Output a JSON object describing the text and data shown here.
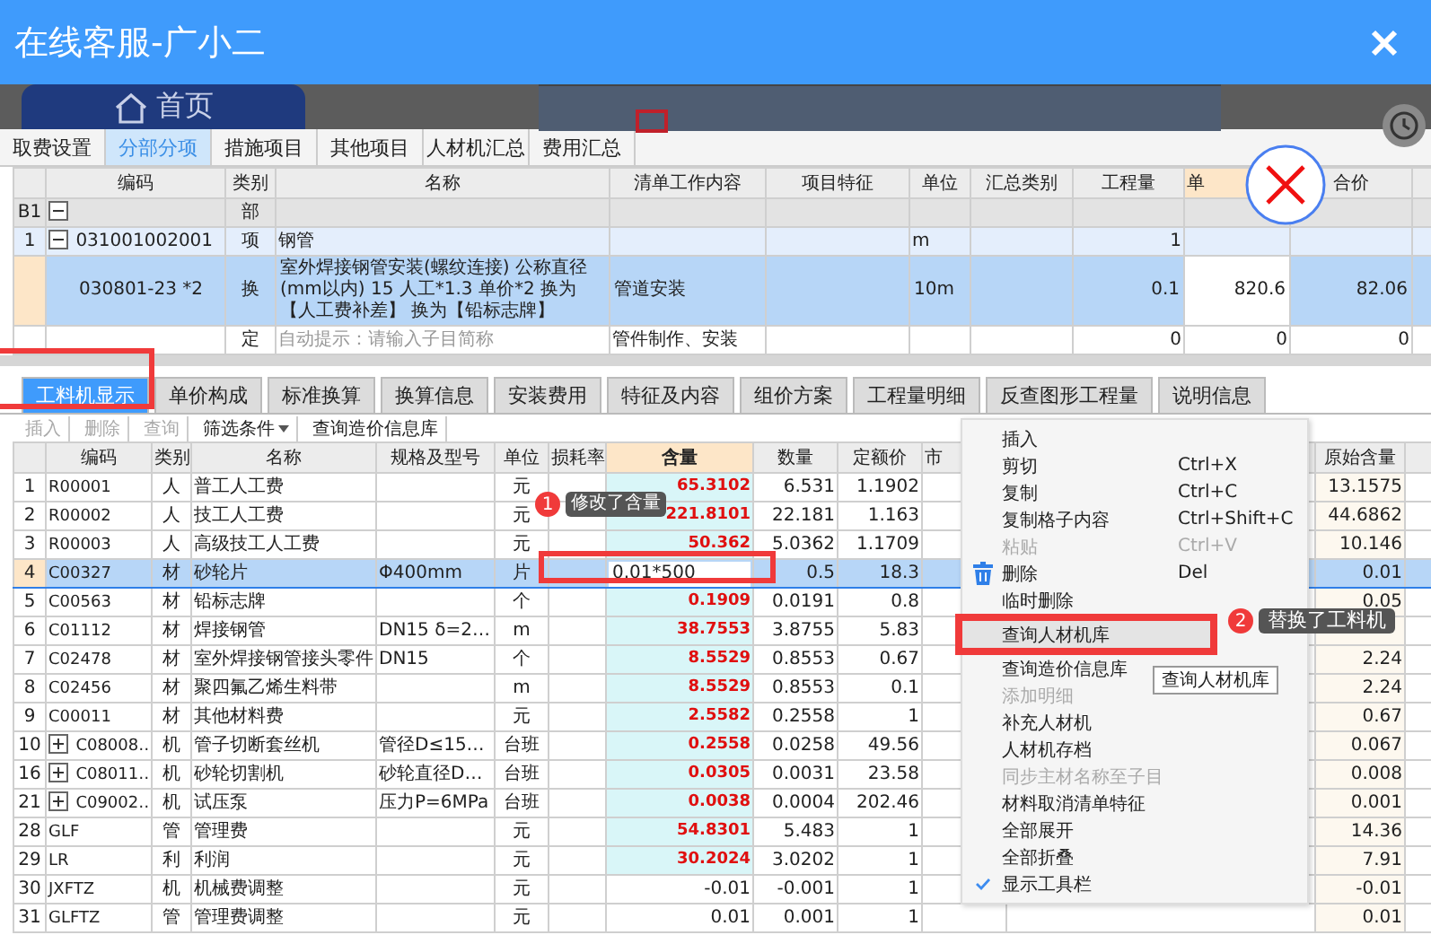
{
  "window": {
    "title": "在线客服-广小二"
  },
  "background_screen": {
    "home_button": "首页"
  },
  "top_tabs": [
    {
      "label": "取费设置",
      "selected": false
    },
    {
      "label": "分部分项",
      "selected": true
    },
    {
      "label": "措施项目",
      "selected": false
    },
    {
      "label": "其他项目",
      "selected": false
    },
    {
      "label": "人材机汇总",
      "selected": false
    },
    {
      "label": "费用汇总",
      "selected": false
    }
  ],
  "item_table": {
    "columns": [
      "编码",
      "类别",
      "名称",
      "清单工作内容",
      "项目特征",
      "单位",
      "汇总类别",
      "工程量",
      "单",
      "合价"
    ],
    "rows": [
      {
        "number": "B1",
        "code": "",
        "expanded": true,
        "type": "部",
        "name": "",
        "work": "",
        "unit": "",
        "quantity": "",
        "price": "",
        "total": "",
        "selected": false
      },
      {
        "number": "1",
        "code": "031001002001",
        "expanded": true,
        "type": "项",
        "name": "钢管",
        "work": "",
        "unit": "m",
        "quantity": "1",
        "price": "",
        "total": "",
        "selected": false
      },
      {
        "number": "",
        "code": "030801-23 *2",
        "type": "换",
        "name": "室外焊接钢管安装(螺纹连接) 公称直径(mm以内) 15  人工*1.3  单价*2  换为【人工费补差】  换为【铅标志牌】",
        "work": "管道安装",
        "unit": "10m",
        "quantity": "0.1",
        "price": "820.6",
        "total": "82.06",
        "selected": true
      },
      {
        "number": "",
        "code": "",
        "type": "定",
        "placeholder": "自动提示：请输入子目简称",
        "work": "管件制作、安装",
        "unit": "",
        "quantity": "0",
        "price": "0",
        "total": "0",
        "selected": false
      }
    ]
  },
  "detail_tabs": [
    {
      "label": "工料机显示",
      "selected": true
    },
    {
      "label": "单价构成",
      "selected": false
    },
    {
      "label": "标准换算",
      "selected": false
    },
    {
      "label": "换算信息",
      "selected": false
    },
    {
      "label": "安装费用",
      "selected": false
    },
    {
      "label": "特征及内容",
      "selected": false
    },
    {
      "label": "组价方案",
      "selected": false
    },
    {
      "label": "工程量明细",
      "selected": false
    },
    {
      "label": "反查图形工程量",
      "selected": false
    },
    {
      "label": "说明信息",
      "selected": false
    }
  ],
  "toolbar": [
    {
      "label": "插入",
      "disabled": true,
      "dropdown": false
    },
    {
      "label": "删除",
      "disabled": true,
      "dropdown": false
    },
    {
      "label": "查询",
      "disabled": true,
      "dropdown": false
    },
    {
      "label": "筛选条件",
      "disabled": false,
      "dropdown": true
    },
    {
      "label": "查询造价信息库",
      "disabled": false,
      "dropdown": false
    }
  ],
  "resource_table": {
    "columns": [
      "编码",
      "类别",
      "名称",
      "规格及型号",
      "单位",
      "损耗率",
      "含量",
      "数量",
      "定额价",
      "市",
      "原始含量"
    ],
    "rows": [
      {
        "number": "1",
        "code": "R00001",
        "type": "人",
        "name": "普工人工费",
        "spec": "",
        "unit": "元",
        "content": "65.3102",
        "changed": true,
        "amount": "6.531",
        "base_price": "1.1902",
        "original": "13.1575",
        "selected": false,
        "editing": false
      },
      {
        "number": "2",
        "code": "R00002",
        "type": "人",
        "name": "技工人工费",
        "spec": "",
        "unit": "元",
        "content": "221.8101",
        "changed": true,
        "amount": "22.181",
        "base_price": "1.163",
        "original": "44.6862",
        "selected": false,
        "editing": false
      },
      {
        "number": "3",
        "code": "R00003",
        "type": "人",
        "name": "高级技工人工费",
        "spec": "",
        "unit": "元",
        "content": "50.362",
        "changed": true,
        "amount": "5.0362",
        "base_price": "1.1709",
        "original": "10.146",
        "selected": false,
        "editing": false
      },
      {
        "number": "4",
        "code": "C00327",
        "type": "材",
        "name": "砂轮片",
        "spec": "Φ400mm",
        "unit": "片",
        "content": "0.01*500",
        "changed": false,
        "amount": "0.5",
        "base_price": "18.3",
        "original": "0.01",
        "selected": true,
        "editing": true
      },
      {
        "number": "5",
        "code": "C00563",
        "type": "材",
        "name": "铅标志牌",
        "spec": "",
        "unit": "个",
        "content": "0.1909",
        "changed": true,
        "amount": "0.0191",
        "base_price": "0.8",
        "original": "0.05",
        "selected": false,
        "editing": false
      },
      {
        "number": "6",
        "code": "C01112",
        "type": "材",
        "name": "焊接钢管",
        "spec": "DN15 δ=2…",
        "unit": "m",
        "content": "38.7553",
        "changed": true,
        "amount": "3.8755",
        "base_price": "5.83",
        "selected": false,
        "editing": false
      },
      {
        "number": "7",
        "code": "C02478",
        "type": "材",
        "name": "室外焊接钢管接头零件",
        "spec": "DN15",
        "unit": "个",
        "content": "8.5529",
        "changed": true,
        "amount": "0.8553",
        "base_price": "0.67",
        "original": "2.24",
        "selected": false,
        "editing": false
      },
      {
        "number": "8",
        "code": "C02456",
        "type": "材",
        "name": "聚四氟乙烯生料带",
        "spec": "",
        "unit": "m",
        "content": "8.5529",
        "changed": true,
        "amount": "0.8553",
        "base_price": "0.1",
        "original": "2.24",
        "selected": false,
        "editing": false
      },
      {
        "number": "9",
        "code": "C00011",
        "type": "材",
        "name": "其他材料费",
        "spec": "",
        "unit": "元",
        "content": "2.5582",
        "changed": true,
        "amount": "0.2558",
        "base_price": "1",
        "original": "0.67",
        "selected": false,
        "editing": false
      },
      {
        "number": "10",
        "code": "C08008…",
        "expanded": false,
        "type": "机",
        "name": "管子切断套丝机",
        "spec": "管径D≤15…",
        "unit": "台班",
        "content": "0.2558",
        "changed": true,
        "amount": "0.0258",
        "base_price": "49.56",
        "original": "0.067",
        "selected": false,
        "editing": false
      },
      {
        "number": "16",
        "code": "C08011…",
        "expanded": false,
        "type": "机",
        "name": "砂轮切割机",
        "spec": "砂轮直径D…",
        "unit": "台班",
        "content": "0.0305",
        "changed": true,
        "amount": "0.0031",
        "base_price": "23.58",
        "original": "0.008",
        "selected": false,
        "editing": false
      },
      {
        "number": "21",
        "code": "C09002…",
        "expanded": false,
        "type": "机",
        "name": "试压泵",
        "spec": "压力P=6MPa",
        "unit": "台班",
        "content": "0.0038",
        "changed": true,
        "amount": "0.0004",
        "base_price": "202.46",
        "original": "0.001",
        "selected": false,
        "editing": false
      },
      {
        "number": "28",
        "code": "GLF",
        "type": "管",
        "name": "管理费",
        "spec": "",
        "unit": "元",
        "content": "54.8301",
        "changed": true,
        "amount": "5.483",
        "base_price": "1",
        "original": "14.36",
        "selected": false,
        "editing": false
      },
      {
        "number": "29",
        "code": "LR",
        "type": "利",
        "name": "利润",
        "spec": "",
        "unit": "元",
        "content": "30.2024",
        "changed": true,
        "amount": "3.0202",
        "base_price": "1",
        "original": "7.91",
        "selected": false,
        "editing": false
      },
      {
        "number": "30",
        "code": "JXFTZ",
        "type": "机",
        "name": "机械费调整",
        "spec": "",
        "unit": "元",
        "content": "-0.01",
        "changed": false,
        "amount": "-0.001",
        "base_price": "1",
        "original": "-0.01",
        "selected": false,
        "editing": false
      },
      {
        "number": "31",
        "code": "GLFTZ",
        "type": "管",
        "name": "管理费调整",
        "spec": "",
        "unit": "元",
        "content": "0.01",
        "changed": false,
        "amount": "0.001",
        "base_price": "1",
        "original": "0.01",
        "selected": false,
        "editing": false
      }
    ]
  },
  "context_menu": {
    "items": [
      {
        "label": "插入",
        "kind": "plain",
        "disabled": false,
        "selected": false,
        "checked": false
      },
      {
        "label": "剪切",
        "shortcut": "Ctrl+X",
        "kind": "plain",
        "disabled": false,
        "selected": false,
        "checked": false
      },
      {
        "label": "复制",
        "shortcut": "Ctrl+C",
        "kind": "plain",
        "disabled": false,
        "selected": false,
        "checked": false
      },
      {
        "label": "复制格子内容",
        "shortcut": "Ctrl+Shift+C",
        "kind": "plain",
        "disabled": false,
        "selected": false,
        "checked": false
      },
      {
        "label": "粘贴",
        "shortcut": "Ctrl+V",
        "kind": "plain",
        "disabled": true,
        "selected": false,
        "checked": false
      },
      {
        "label": "删除",
        "shortcut": "Del",
        "kind": "trash",
        "disabled": false,
        "selected": false,
        "checked": false
      },
      {
        "label": "临时删除",
        "kind": "plain",
        "disabled": false,
        "selected": false,
        "checked": false
      },
      {
        "label": "查询人材机库",
        "kind": "plain",
        "disabled": false,
        "selected": true,
        "checked": false
      },
      {
        "label": "查询造价信息库",
        "kind": "plain",
        "disabled": false,
        "selected": false,
        "checked": false
      },
      {
        "label": "添加明细",
        "kind": "plain",
        "disabled": true,
        "selected": false,
        "checked": false
      },
      {
        "label": "补充人材机",
        "kind": "plain",
        "disabled": false,
        "selected": false,
        "checked": false
      },
      {
        "label": "人材机存档",
        "kind": "plain",
        "disabled": false,
        "selected": false,
        "checked": false
      },
      {
        "label": "同步主材名称至子目",
        "kind": "plain",
        "disabled": true,
        "selected": false,
        "checked": false
      },
      {
        "label": "材料取消清单特征",
        "kind": "plain",
        "disabled": false,
        "selected": false,
        "checked": false
      },
      {
        "label": "全部展开",
        "kind": "plain",
        "disabled": false,
        "selected": false,
        "checked": false
      },
      {
        "label": "全部折叠",
        "kind": "plain",
        "disabled": false,
        "selected": false,
        "checked": false
      },
      {
        "label": "显示工具栏",
        "kind": "plain",
        "disabled": false,
        "selected": false,
        "checked": true
      }
    ]
  },
  "menu_tooltip": "查询人材机库",
  "callouts": [
    {
      "number": "1",
      "text": "修改了含量"
    },
    {
      "number": "2",
      "text": "替换了工料机"
    }
  ]
}
